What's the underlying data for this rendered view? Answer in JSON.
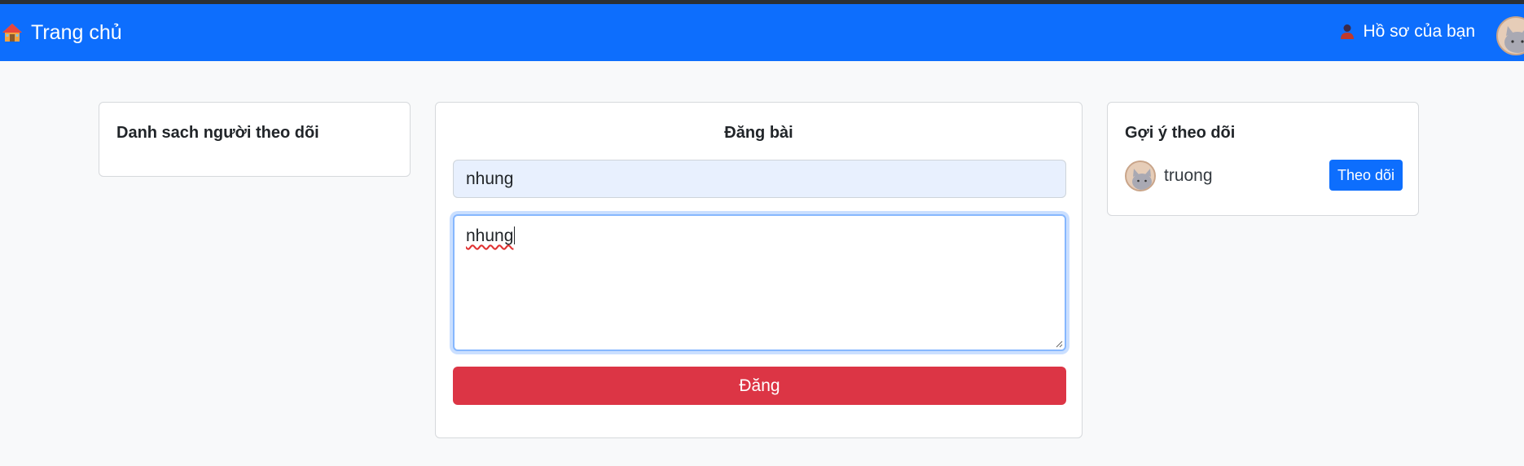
{
  "navbar": {
    "brand_label": "Trang chủ",
    "brand_icon": "house-icon",
    "profile_label": "Hồ sơ của bạn",
    "profile_icon": "user-icon",
    "color": "#0d6efd"
  },
  "followers_card": {
    "title": "Danh sach người theo dõi"
  },
  "post_card": {
    "title": "Đăng bài",
    "title_input_value": "nhung",
    "content_value": "nhung",
    "submit_label": "Đăng",
    "submit_color": "#dc3545"
  },
  "suggestions_card": {
    "title": "Gợi ý theo dõi",
    "items": [
      {
        "name": "truong",
        "button_label": "Theo dõi"
      }
    ]
  }
}
